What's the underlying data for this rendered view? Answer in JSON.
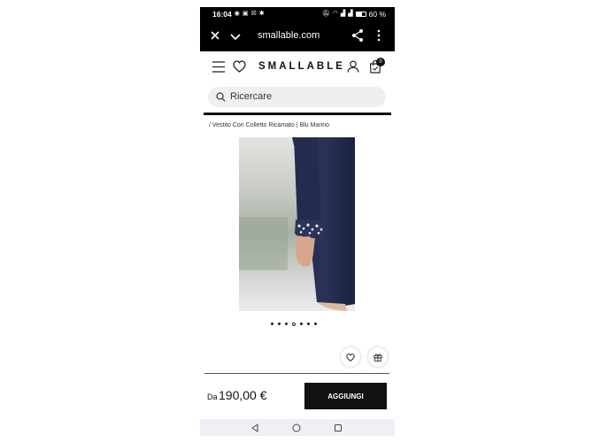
{
  "status_bar": {
    "time": "16:04",
    "battery_percent": 60,
    "battery_label": "60 %"
  },
  "browser": {
    "url": "smallable.com",
    "icons": [
      "close-icon",
      "chevron-down-icon",
      "share-icon",
      "more-vertical-icon"
    ]
  },
  "header": {
    "logo": "SMALLABLE",
    "cart_count": "0",
    "icons": [
      "hamburger-menu-icon",
      "heart-icon",
      "user-icon",
      "shopping-bag-icon"
    ]
  },
  "search": {
    "placeholder": "Ricercare"
  },
  "breadcrumb": "/ Vestito Con Colletto Ricamato | Blu Marino",
  "product": {
    "carousel": {
      "total": 7,
      "active_index": 3
    }
  },
  "price": {
    "prefix": "Da",
    "amount": "190,00 €"
  },
  "cta": {
    "add_label": "AGGIUNGI"
  },
  "colors": {
    "primary": "#111111",
    "search_bg": "#efefef",
    "nav_bar_bg": "#f2eef6"
  }
}
